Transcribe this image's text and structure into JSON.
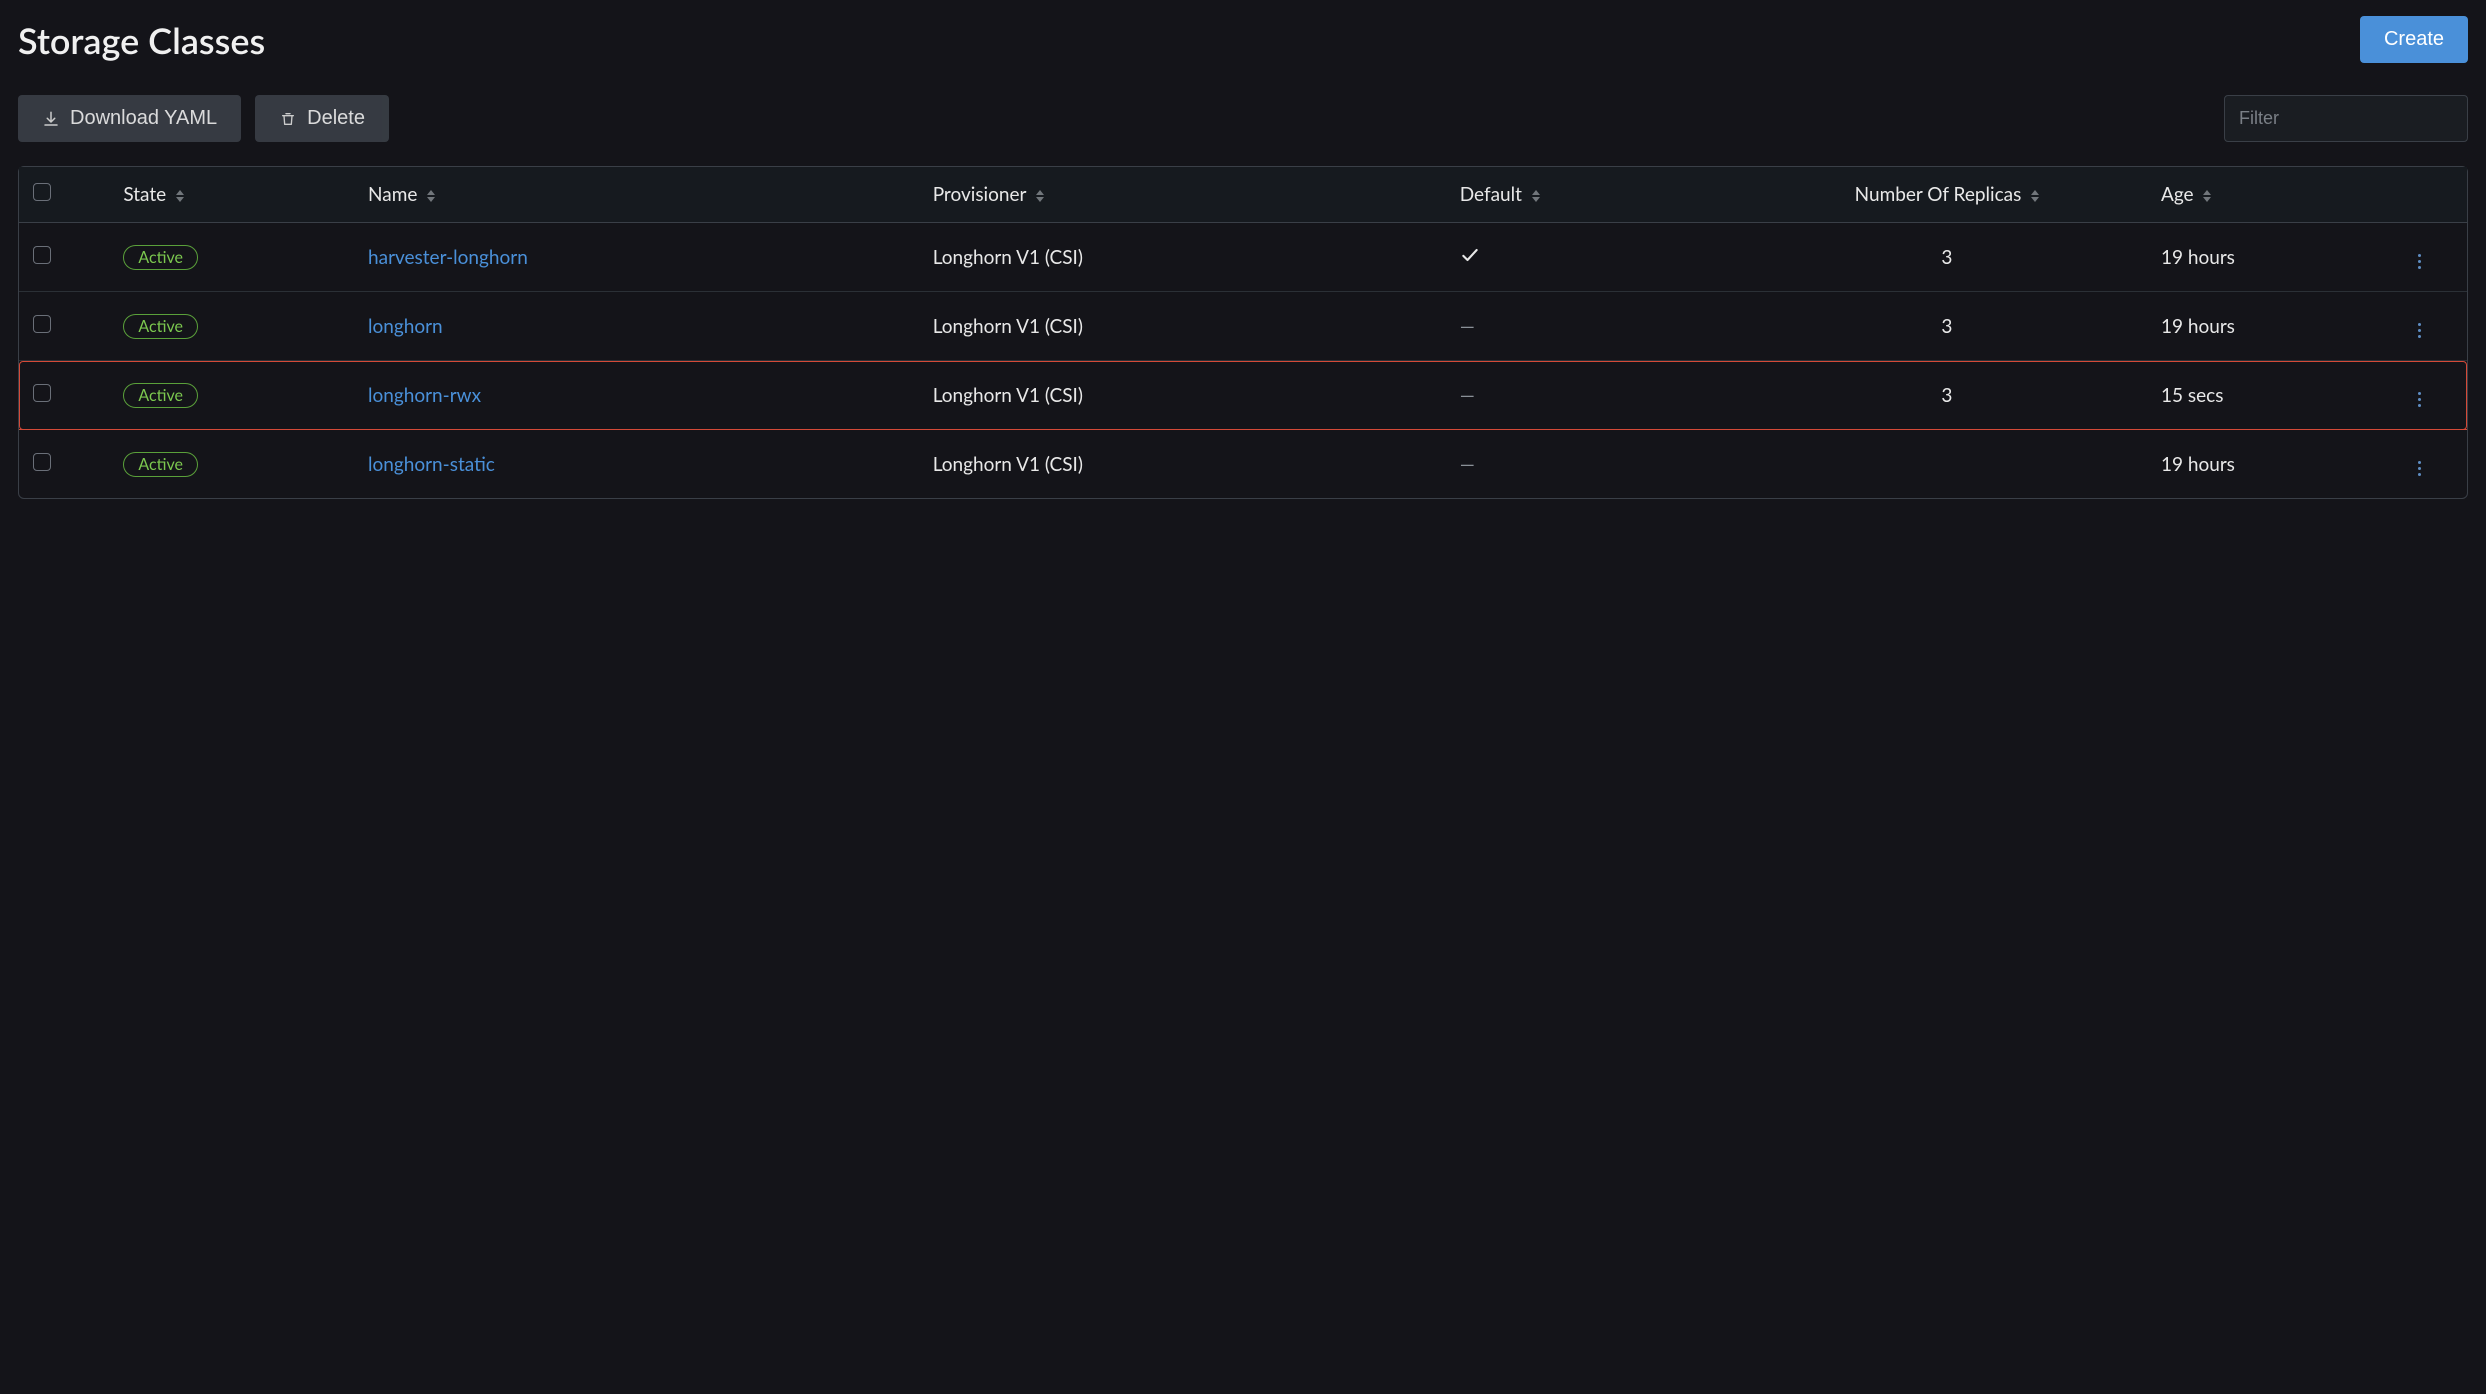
{
  "header": {
    "title": "Storage Classes",
    "create_label": "Create"
  },
  "toolbar": {
    "download_yaml_label": "Download YAML",
    "delete_label": "Delete",
    "filter_placeholder": "Filter"
  },
  "table": {
    "columns": {
      "state": "State",
      "name": "Name",
      "provisioner": "Provisioner",
      "default": "Default",
      "number_of_replicas": "Number Of Replicas",
      "age": "Age"
    },
    "rows": [
      {
        "state": "Active",
        "name": "harvester-longhorn",
        "provisioner": "Longhorn V1 (CSI)",
        "default": true,
        "replicas": "3",
        "age": "19 hours",
        "highlighted": false
      },
      {
        "state": "Active",
        "name": "longhorn",
        "provisioner": "Longhorn V1 (CSI)",
        "default": false,
        "replicas": "3",
        "age": "19 hours",
        "highlighted": false
      },
      {
        "state": "Active",
        "name": "longhorn-rwx",
        "provisioner": "Longhorn V1 (CSI)",
        "default": false,
        "replicas": "3",
        "age": "15 secs",
        "highlighted": true
      },
      {
        "state": "Active",
        "name": "longhorn-static",
        "provisioner": "Longhorn V1 (CSI)",
        "default": false,
        "replicas": "",
        "age": "19 hours",
        "highlighted": false
      }
    ]
  }
}
